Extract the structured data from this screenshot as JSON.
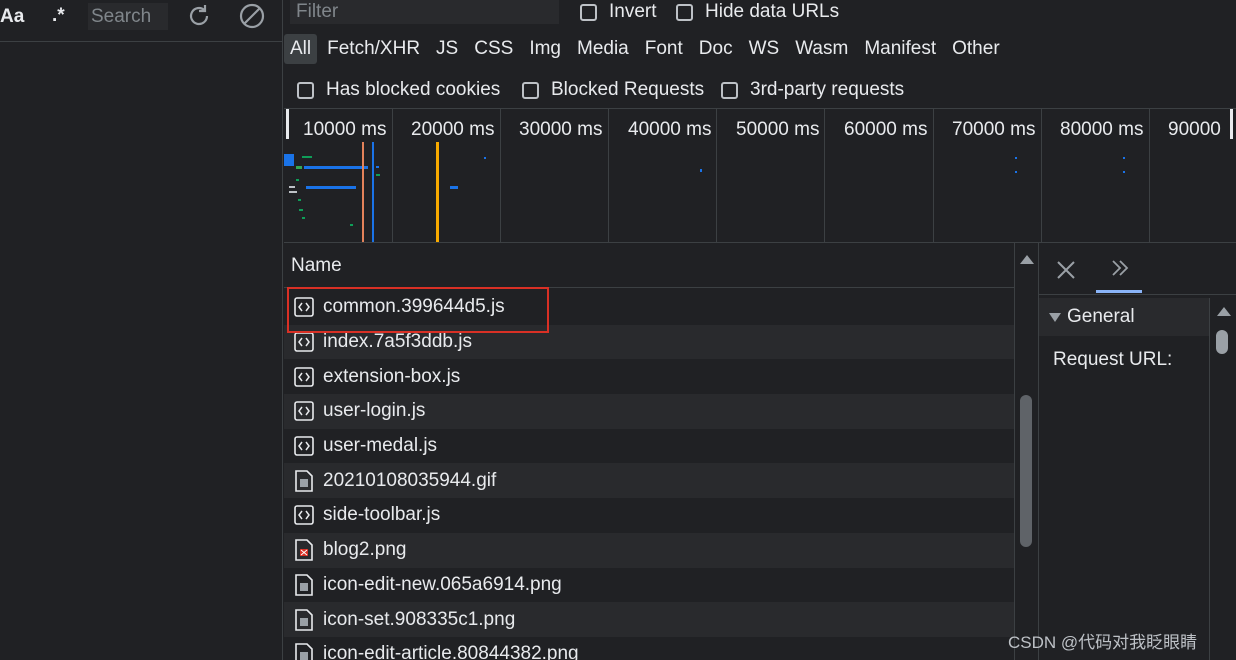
{
  "search_sidebar": {
    "match_case_label": "Aa",
    "regex_label": ".*",
    "search_placeholder": "Search",
    "refresh_icon": "refresh-icon",
    "clear_icon": "clear-icon"
  },
  "filter_bar": {
    "filter_placeholder": "Filter",
    "invert_label": "Invert",
    "invert_checked": false,
    "hide_data_urls_label": "Hide data URLs",
    "hide_data_urls_checked": false
  },
  "type_filters": [
    "All",
    "Fetch/XHR",
    "JS",
    "CSS",
    "Img",
    "Media",
    "Font",
    "Doc",
    "WS",
    "Wasm",
    "Manifest",
    "Other"
  ],
  "active_type_filter": "All",
  "extra_filters": {
    "blocked_cookies_label": "Has blocked cookies",
    "blocked_requests_label": "Blocked Requests",
    "third_party_label": "3rd-party requests"
  },
  "timeline": {
    "ticks": [
      "10000 ms",
      "20000 ms",
      "30000 ms",
      "40000 ms",
      "50000 ms",
      "60000 ms",
      "70000 ms",
      "80000 ms",
      "90000"
    ],
    "dom_content_loaded_color": "#1a73e8",
    "load_color": "#f9ab00"
  },
  "request_list": {
    "column_header": "Name",
    "selected_index": 0,
    "highlight_color": "#d93025",
    "rows": [
      {
        "name": "common.399644d5.js",
        "icon": "script-icon"
      },
      {
        "name": "index.7a5f3ddb.js",
        "icon": "script-icon"
      },
      {
        "name": "extension-box.js",
        "icon": "script-icon"
      },
      {
        "name": "user-login.js",
        "icon": "script-icon"
      },
      {
        "name": "user-medal.js",
        "icon": "script-icon"
      },
      {
        "name": "20210108035944.gif",
        "icon": "image-file-icon"
      },
      {
        "name": "side-toolbar.js",
        "icon": "script-icon"
      },
      {
        "name": "blog2.png",
        "icon": "broken-image-icon"
      },
      {
        "name": "icon-edit-new.065a6914.png",
        "icon": "image-file-icon"
      },
      {
        "name": "icon-set.908335c1.png",
        "icon": "image-file-icon"
      },
      {
        "name": "icon-edit-article.80844382.png",
        "icon": "image-file-icon"
      }
    ]
  },
  "details_pane": {
    "close_icon": "close-icon",
    "more_tabs_icon": "double-chevron-icon",
    "section_title": "General",
    "request_url_label": "Request URL:"
  },
  "watermark": "CSDN @代码对我眨眼睛"
}
